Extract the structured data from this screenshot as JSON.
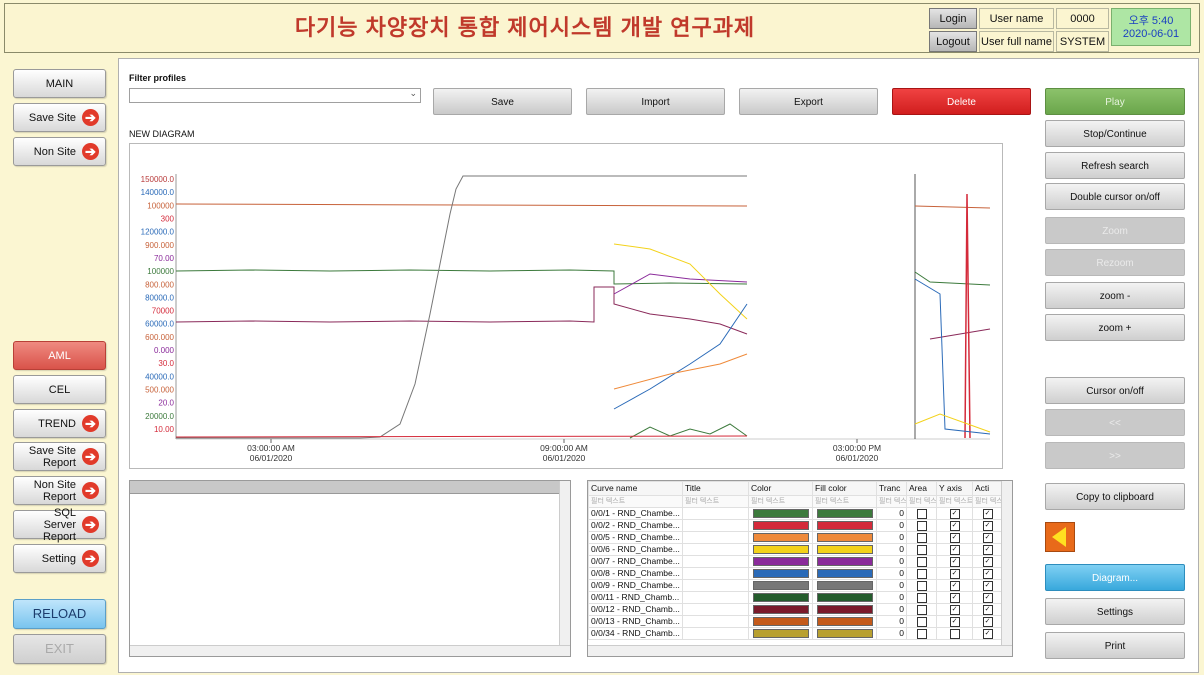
{
  "header": {
    "title": "다기능 차양장치 통합 제어시스템 개발 연구과제",
    "login_label": "Login",
    "logout_label": "Logout",
    "user_name_label": "User name",
    "user_full_name_label": "User full name",
    "user_name_value": "0000",
    "user_full_name_value": "SYSTEM",
    "time": "오후 5:40",
    "date": "2020-06-01"
  },
  "sidebar": {
    "main": "MAIN",
    "save_site": "Save Site",
    "non_site": "Non Site",
    "aml": "AML",
    "cel": "CEL",
    "trend": "TREND",
    "save_site_report": "Save Site Report",
    "non_site_report": "Non Site Report",
    "sql_server_report": "SQL Server Report",
    "setting": "Setting",
    "reload": "RELOAD",
    "exit": "EXIT"
  },
  "toolbar": {
    "filter_profiles_label": "Filter profiles",
    "filter_value": "",
    "save": "Save",
    "import": "Import",
    "export": "Export",
    "delete": "Delete"
  },
  "diagram": {
    "title": "NEW DIAGRAM"
  },
  "right_panel": {
    "play": "Play",
    "stop_continue": "Stop/Continue",
    "refresh_search": "Refresh search",
    "double_cursor": "Double cursor on/off",
    "zoom": "Zoom",
    "rezoom": "Rezoom",
    "zoom_minus": "zoom -",
    "zoom_plus": "zoom +",
    "cursor_onoff": "Cursor on/off",
    "prev": "<<",
    "next": ">>",
    "copy_clipboard": "Copy to clipboard",
    "diagram": "Diagram...",
    "settings": "Settings",
    "print": "Print"
  },
  "curve_table": {
    "columns": [
      "Curve name",
      "Title",
      "Color",
      "Fill color",
      "Tranc",
      "Area",
      "Y axis",
      "Acti"
    ],
    "filter_placeholder": "필터 텍스트",
    "rows": [
      {
        "name": "0/0/1 - RND_Chambe...",
        "color": "#3c7a3c",
        "fill": "#3c7a3c",
        "tranc": "0",
        "area": false,
        "yaxis": true,
        "active": true
      },
      {
        "name": "0/0/2 - RND_Chambe...",
        "color": "#d42a3a",
        "fill": "#d42a3a",
        "tranc": "0",
        "area": false,
        "yaxis": true,
        "active": true
      },
      {
        "name": "0/0/5 - RND_Chambe...",
        "color": "#ef8a3a",
        "fill": "#ef8a3a",
        "tranc": "0",
        "area": false,
        "yaxis": true,
        "active": true
      },
      {
        "name": "0/0/6 - RND_Chambe...",
        "color": "#f3d21a",
        "fill": "#f3d21a",
        "tranc": "0",
        "area": false,
        "yaxis": true,
        "active": true
      },
      {
        "name": "0/0/7 - RND_Chambe...",
        "color": "#8a2a9a",
        "fill": "#8a2a9a",
        "tranc": "0",
        "area": false,
        "yaxis": true,
        "active": true
      },
      {
        "name": "0/0/8 - RND_Chambe...",
        "color": "#2a6ab8",
        "fill": "#2a6ab8",
        "tranc": "0",
        "area": false,
        "yaxis": true,
        "active": true
      },
      {
        "name": "0/0/9 - RND_Chambe...",
        "color": "#777777",
        "fill": "#777777",
        "tranc": "0",
        "area": false,
        "yaxis": true,
        "active": true
      },
      {
        "name": "0/0/11 - RND_Chamb...",
        "color": "#245c2c",
        "fill": "#245c2c",
        "tranc": "0",
        "area": false,
        "yaxis": true,
        "active": true
      },
      {
        "name": "0/0/12 - RND_Chamb...",
        "color": "#7a1a2a",
        "fill": "#7a1a2a",
        "tranc": "0",
        "area": false,
        "yaxis": true,
        "active": true
      },
      {
        "name": "0/0/13 - RND_Chamb...",
        "color": "#c45a1a",
        "fill": "#c45a1a",
        "tranc": "0",
        "area": false,
        "yaxis": true,
        "active": true
      },
      {
        "name": "0/0/34 - RND_Chamb...",
        "color": "#b8a030",
        "fill": "#b8a030",
        "tranc": "0",
        "area": false,
        "yaxis": false,
        "active": true
      }
    ]
  },
  "chart_data": {
    "type": "line",
    "x_ticks": [
      {
        "time": "03:00:00 AM",
        "date": "06/01/2020"
      },
      {
        "time": "09:00:00 AM",
        "date": "06/01/2020"
      },
      {
        "time": "03:00:00 PM",
        "date": "06/01/2020"
      }
    ],
    "y_tick_labels": [
      "150000.0",
      "140000.0",
      "100000",
      "300",
      "120000.0",
      "900.000",
      "70.00",
      "100000",
      "800.000",
      "80000.0",
      "70000",
      "60000.0",
      "600.000",
      "0.000",
      "30.0",
      "40000.0",
      "500.000",
      "20.0",
      "20000.0",
      "10.00"
    ],
    "grid": false,
    "legend": "none"
  }
}
